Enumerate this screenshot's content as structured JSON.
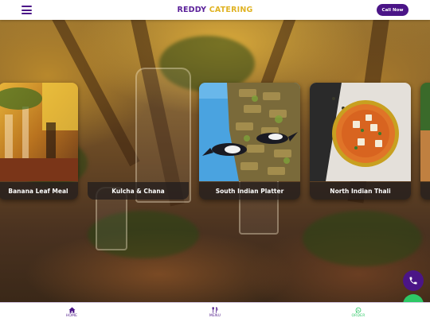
{
  "header": {
    "brand_part1": "REDDY",
    "brand_part2": "CATERING",
    "call_button": "Call Now",
    "menu_icon": "hamburger-icon"
  },
  "carousel": {
    "items": [
      {
        "label": "Banana Leaf Meal",
        "image": "table-setting-photo"
      },
      {
        "label": "Kulcha & Chana",
        "image": "blurred-background"
      },
      {
        "label": "South Indian Platter",
        "image": "magpie-birds-photo"
      },
      {
        "label": "North Indian Thali",
        "image": "curry-bowl-photo"
      }
    ]
  },
  "floating": {
    "call_icon": "phone-icon",
    "chat_icon": "whatsapp-icon"
  },
  "bottom_nav": {
    "items": [
      {
        "label": "HOME",
        "icon": "home-icon"
      },
      {
        "label": "MENU",
        "icon": "utensils-icon"
      },
      {
        "label": "ORDER",
        "icon": "whatsapp-icon"
      }
    ]
  },
  "colors": {
    "primary": "#4b1587",
    "accent": "#e0b324",
    "whatsapp": "#2ec866"
  }
}
